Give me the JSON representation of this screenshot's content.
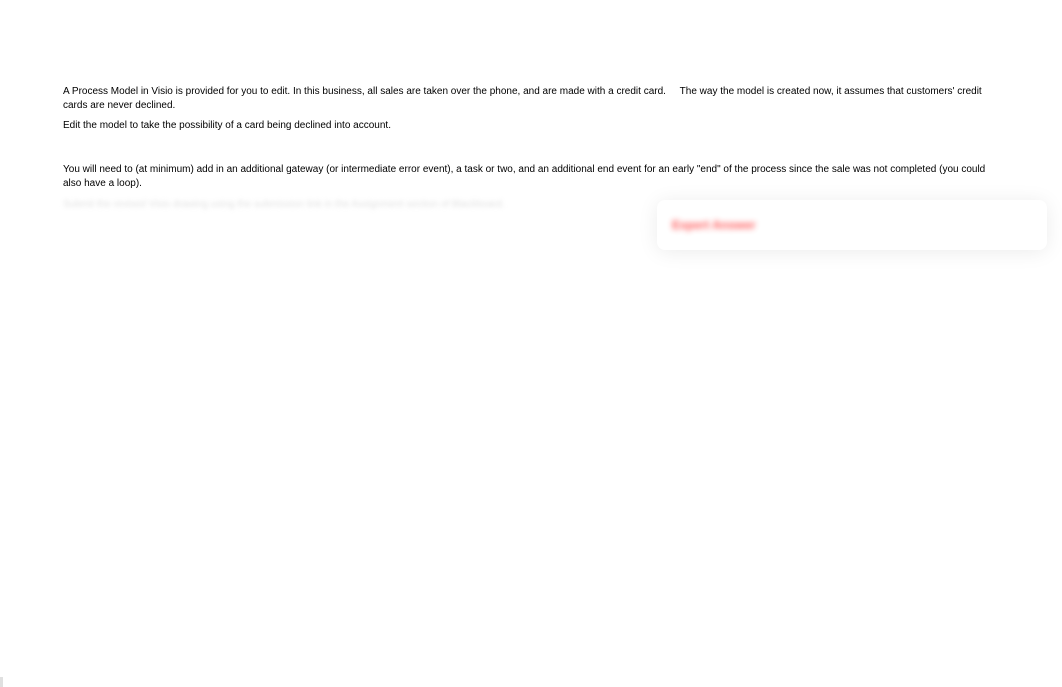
{
  "question": {
    "para1_part1": "A Process Model in Visio is provided for you to edit.",
    "para1_part2": "In this business, all sales are taken over the phone, and are made with a credit card.",
    "para1_part3": "The way the model is created now, it assumes that customers' credit cards are never declined.",
    "para1_line2": "Edit the model to take the possibility of a card being declined into account.",
    "para2": "You will need to (at minimum) add in an additional gateway (or intermediate error event), a task or two, and an additional end event for an early \"end\" of the process since the sale was not completed (you could also have a loop).",
    "blurred": "Submit the revised Visio drawing using the submission link in the Assignment section of Blackboard."
  },
  "callout": {
    "text": "Expert Answer"
  }
}
